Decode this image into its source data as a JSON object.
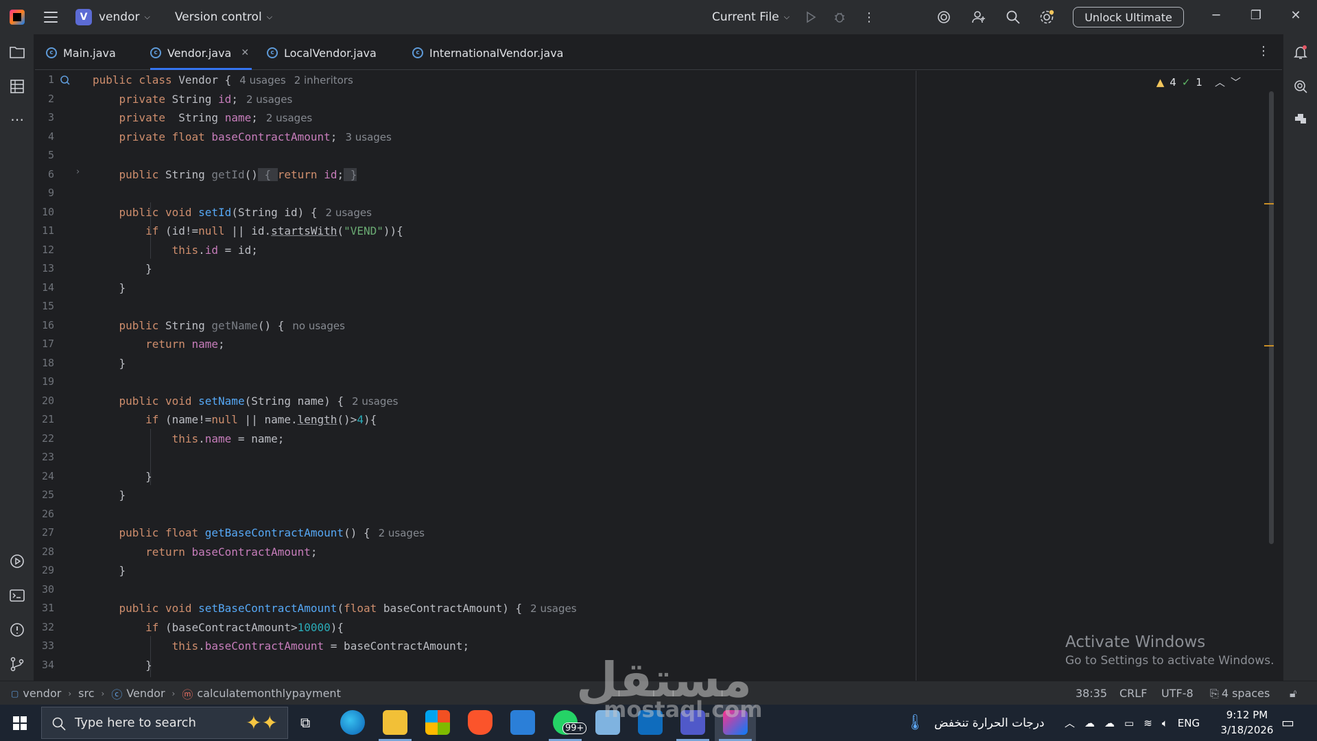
{
  "titlebar": {
    "project_letter": "V",
    "project_name": "vendor",
    "vcs_label": "Version control",
    "run_config": "Current File",
    "unlock_label": "Unlock Ultimate"
  },
  "tabs": [
    {
      "label": "Main.java"
    },
    {
      "label": "Vendor.java",
      "active": true
    },
    {
      "label": "LocalVendor.java"
    },
    {
      "label": "InternationalVendor.java"
    }
  ],
  "editor": {
    "inspection_warnings": "4",
    "inspection_ok": "1",
    "line_numbers": [
      "1",
      "2",
      "3",
      "4",
      "5",
      "6",
      "9",
      "10",
      "11",
      "12",
      "13",
      "14",
      "15",
      "16",
      "17",
      "18",
      "19",
      "20",
      "21",
      "22",
      "23",
      "24",
      "25",
      "26",
      "27",
      "28",
      "29",
      "30",
      "31",
      "32",
      "33",
      "34"
    ],
    "hints": {
      "l1a": "4 usages",
      "l1b": "2 inheritors",
      "l2": "2 usages",
      "l3": "2 usages",
      "l4": "3 usages",
      "l10": "2 usages",
      "l16": "no usages",
      "l20": "2 usages",
      "l27": "2 usages",
      "l31": "2 usages"
    },
    "code": {
      "l1_kw": "public class",
      "l1_name": "Vendor {",
      "l2_kw": "private",
      "l2_type": "String",
      "l2_field": "id",
      "l3_kw": "private",
      "l3_type": " String",
      "l3_field": "name",
      "l4_kw": "private float",
      "l4_field": "baseContractAmount",
      "l6_kw": "public",
      "l6_type": "String",
      "l6_fn": "getId",
      "l6_paren": "()",
      "l6_open": " { ",
      "l6_ret": "return",
      "l6_field": "id",
      "l6_semi": ";",
      "l6_close": " }",
      "l10_kw": "public void",
      "l10_fn": "setId",
      "l10_rest": "(String id) {",
      "l11_if": "if",
      "l11_a": " (id!=",
      "l11_null": "null",
      "l11_b": " || id.",
      "l11_call": "startsWith",
      "l11_c": "(",
      "l11_str": "\"VEND\"",
      "l11_d": ")){",
      "l12_this": "this",
      "l12_dot": ".",
      "l12_field": "id",
      "l12_rest": " = id;",
      "brace": "}",
      "l16_kw": "public",
      "l16_type": "String",
      "l16_fn": "getName",
      "l16_rest": "() {",
      "l17_ret": "return",
      "l17_field": "name",
      "l17_semi": ";",
      "l20_kw": "public void",
      "l20_fn": "setName",
      "l20_rest": "(String name) {",
      "l21_if": "if",
      "l21_a": " (name!=",
      "l21_null": "null",
      "l21_b": " || name.",
      "l21_call": "length",
      "l21_c": "()>",
      "l21_num": "4",
      "l21_d": "){",
      "l22_this": "this",
      "l22_dot": ".",
      "l22_field": "name",
      "l22_rest": " = name;",
      "l27_kw": "public float",
      "l27_fn": "getBaseContractAmount",
      "l27_rest": "() {",
      "l28_ret": "return",
      "l28_field": "baseContractAmount",
      "l28_semi": ";",
      "l31_kw": "public void",
      "l31_fn": "setBaseContractAmount",
      "l31_a": "(",
      "l31_kw2": "float",
      "l31_b": " baseContractAmount) {",
      "l32_if": "if",
      "l32_a": " (baseContractAmount>",
      "l32_num": "10000",
      "l32_b": "){",
      "l33_this": "this",
      "l33_dot": ".",
      "l33_field": "baseContractAmount",
      "l33_rest": " = baseContractAmount;"
    },
    "activate_title": "Activate Windows",
    "activate_sub": "Go to Settings to activate Windows."
  },
  "statusbar": {
    "crumbs": [
      "vendor",
      "src",
      "Vendor",
      "calculatemonthlypayment"
    ],
    "position": "38:35",
    "line_sep": "CRLF",
    "encoding": "UTF-8",
    "indent": "4 spaces"
  },
  "taskbar": {
    "search_placeholder": "Type here to search",
    "whatsapp_badge": "99+",
    "weather": "درجات الحرارة تنخفض",
    "lang": "ENG",
    "time": "9:12 PM",
    "date": "3/18/2026"
  },
  "watermark": {
    "arabic": "مستقل",
    "latin": "mostaql.com"
  },
  "colors": {
    "accent": "#3574f0",
    "keyword": "#cf8e6d",
    "field": "#c77dbb",
    "function": "#56a8f5",
    "string": "#6aab73",
    "number": "#2aacb8"
  }
}
